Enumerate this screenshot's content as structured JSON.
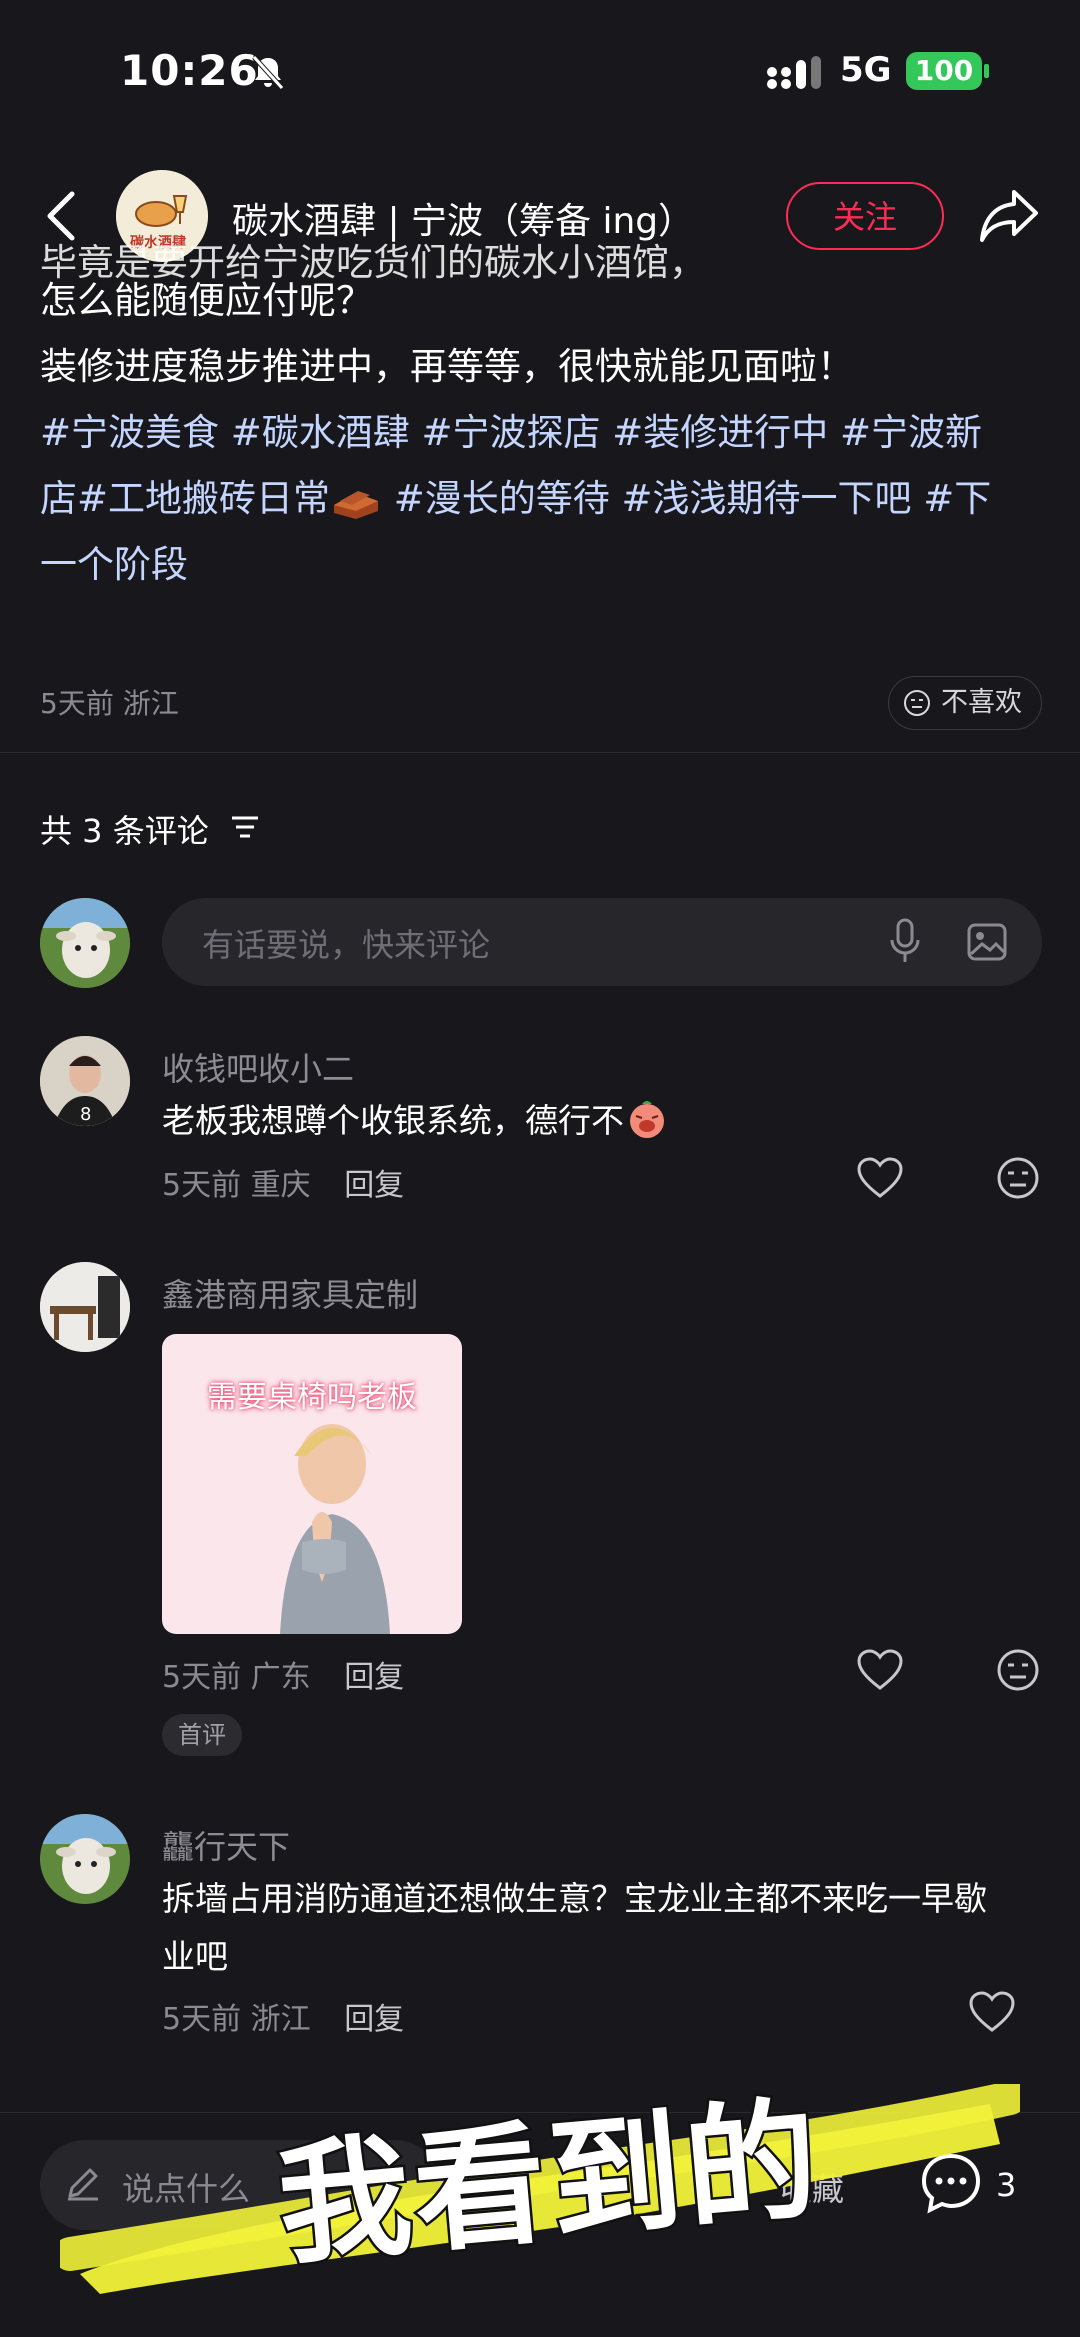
{
  "status_bar": {
    "time": "10:26",
    "network": "5G",
    "battery": "100"
  },
  "header": {
    "title": "碳水酒肆 | 宁波（筹备 ing）",
    "follow_label": "关注",
    "avatar_text": "碳水酒肆"
  },
  "post": {
    "clipped_line": "毕竟是要开给宁波吃货们的碳水小酒馆，",
    "line2": "怎么能随便应付呢？",
    "line3": "装修进度稳步推进中，再等等，很快就能见面啦！",
    "tags_1": "#宁波美食 #碳水酒肆 #宁波探店 #装修进行中 #宁波新",
    "tags_2a": "店#工地搬砖日常",
    "tags_2b": " #漫长的等待 #浅浅期待一下吧 #下",
    "tags_3": "一个阶段",
    "meta": "5天前 浙江",
    "dislike_label": "不喜欢"
  },
  "comments_header": {
    "count_label": "共 3 条评论"
  },
  "comment_input": {
    "placeholder": "有话要说，快来评论"
  },
  "comments": [
    {
      "name": "收钱吧收小二",
      "text": "老板我想蹲个收银系统，德行不",
      "time": "5天前",
      "location": "重庆",
      "reply": "回复"
    },
    {
      "name": "鑫港商用家具定制",
      "image_caption": "需要桌椅吗老板",
      "time": "5天前",
      "location": "广东",
      "reply": "回复",
      "badge": "首评"
    },
    {
      "name": "龘行天下",
      "text_1": "拆墙占用消防通道还想做生意？宝龙业主都不来吃一早歇",
      "text_2": "业吧",
      "time": "5天前",
      "location": "浙江",
      "reply": "回复"
    }
  ],
  "bottom_bar": {
    "input_placeholder": "说点什么",
    "collect_label": "收藏",
    "comment_count": "3"
  },
  "overlay": {
    "text": "我看到的"
  },
  "colors": {
    "background": "#18181c",
    "accent": "#fe2c55",
    "tag": "#c4d6ff",
    "battery": "#34c759",
    "highlight": "#f2f23a"
  }
}
